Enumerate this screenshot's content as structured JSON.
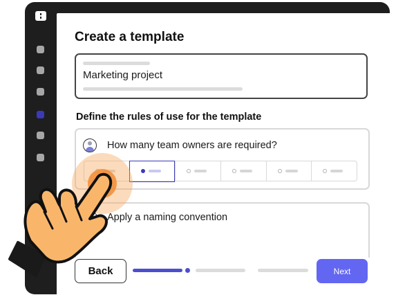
{
  "app": {
    "title": "Create a template"
  },
  "template_name": {
    "value": "Marketing project"
  },
  "rules": {
    "heading": "Define the rules of use for the template",
    "owners_question": "How many team owners are required?",
    "owner_options_count": 6,
    "selected_option_index": 1,
    "naming_convention": "Apply a naming convention"
  },
  "footer": {
    "back_label": "Back",
    "next_label": "Next",
    "progress_step": 1,
    "progress_total": 3
  },
  "colors": {
    "accent": "#6366f1",
    "selected": "#3b3ab8",
    "touch": "#f18c34",
    "hand": "#f9b66b"
  },
  "icons": [
    "app-logo-icon",
    "user-icon",
    "pointing-hand-icon"
  ]
}
